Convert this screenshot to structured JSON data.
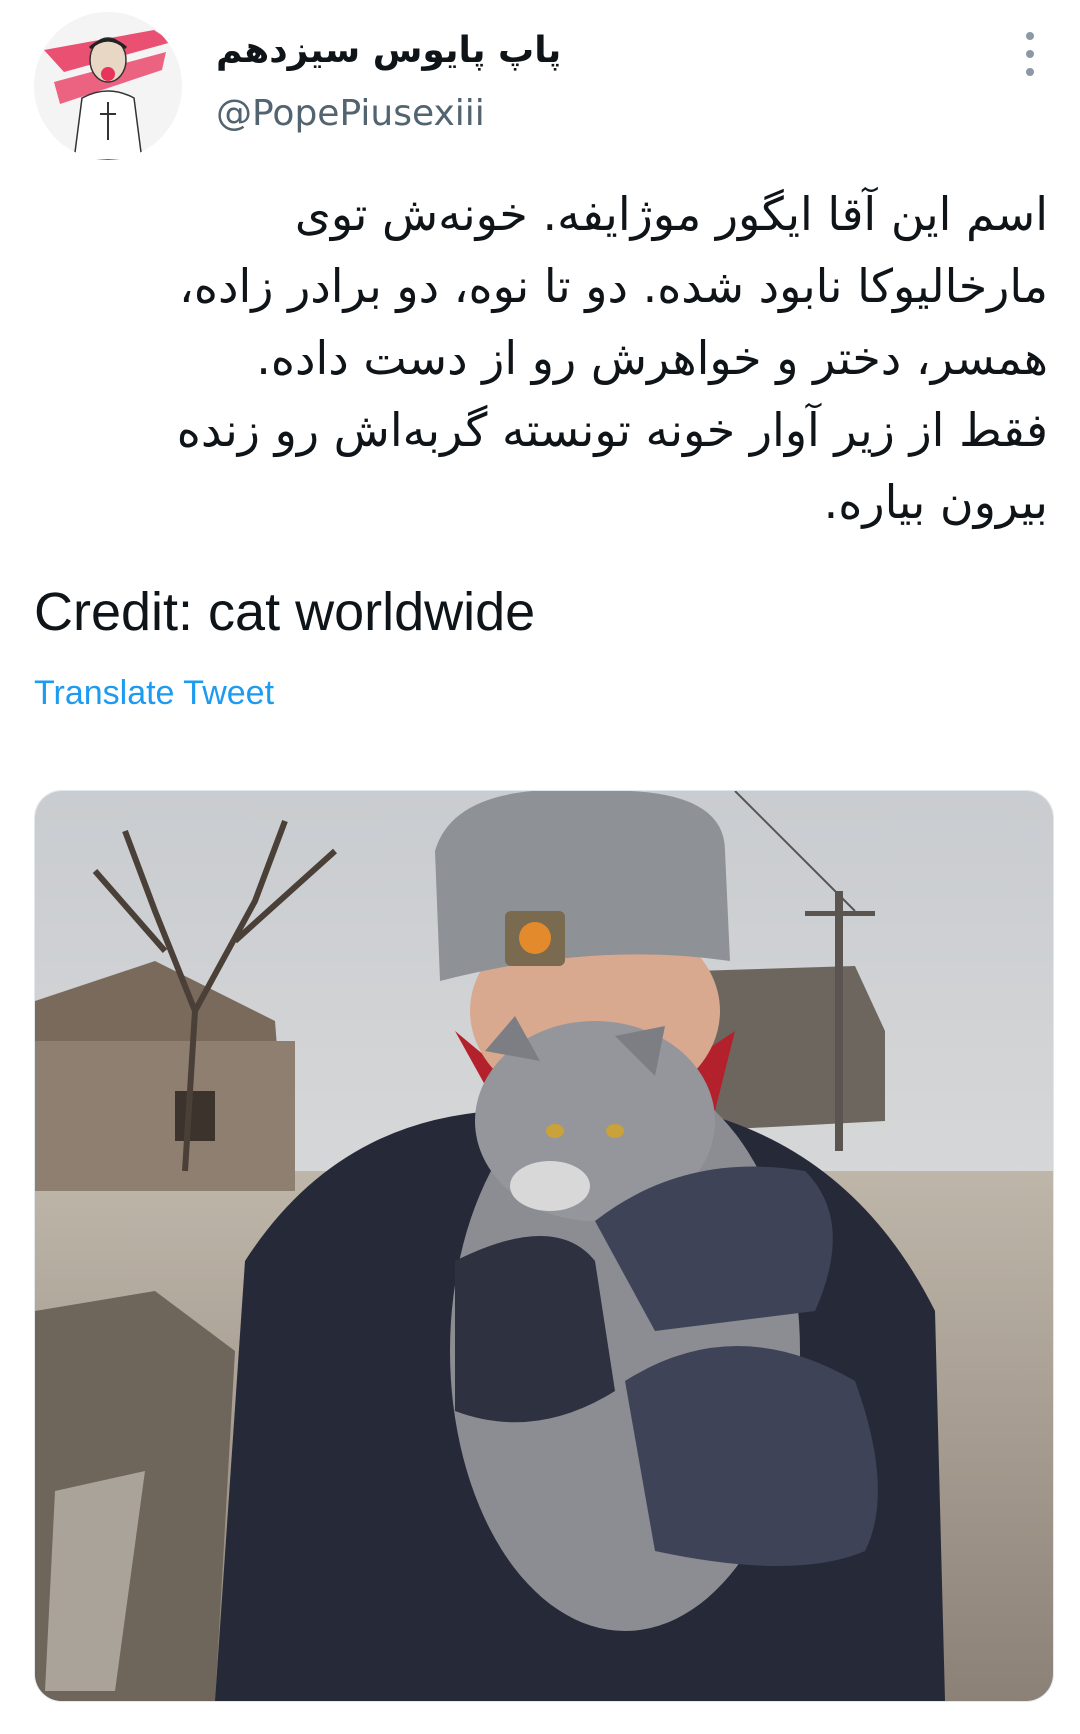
{
  "tweet": {
    "display_name": "پاپ پایوس سیزدهم",
    "handle": "@PopePiusexiii",
    "text_lines": [
      "اسم این آقا ایگور موژایفه. خونه‌ش توی",
      "مارخالیوکا نابود شده. دو تا نوه، دو برادر زاده،",
      "همسر، دختر و خواهرش رو از دست داده.",
      "فقط از زیر آوار خونه تونسته گربه‌اش رو زنده",
      "بیرون بیاره."
    ],
    "credit": "Credit: cat worldwide",
    "translate_label": "Translate Tweet"
  },
  "icons": {
    "more": "more-vertical-icon",
    "avatar": "profile-avatar"
  },
  "colors": {
    "link": "#1d9bf0",
    "handle": "#536471",
    "text": "#0f1419",
    "more": "#8b98a5"
  }
}
